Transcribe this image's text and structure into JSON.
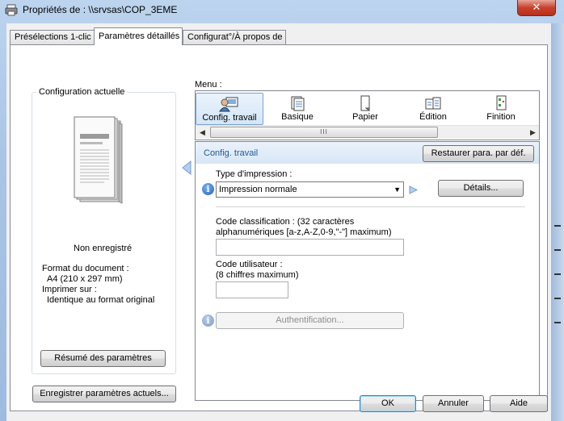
{
  "window": {
    "title": "Propriétés de : \\\\srvsas\\COP_3EME",
    "close_label": "✕"
  },
  "tabs": [
    {
      "label": "Présélections 1-clic",
      "active": false
    },
    {
      "label": "Paramètres détaillés",
      "active": true
    },
    {
      "label": "Configurat°/À propos de",
      "active": false
    }
  ],
  "left_panel": {
    "group_title": "Configuration actuelle",
    "status": "Non enregistré",
    "doc_format_label": "Format du document :",
    "doc_format_value": "A4 (210 x 297 mm)",
    "print_on_label": "Imprimer sur :",
    "print_on_value": "Identique au format original",
    "summary_button": "Résumé des paramètres",
    "save_button": "Enregistrer paramètres actuels..."
  },
  "menu": {
    "label": "Menu :",
    "items": [
      {
        "label": "Config. travail",
        "icon": "job-config-icon",
        "selected": true
      },
      {
        "label": "Basique",
        "icon": "basic-icon",
        "selected": false
      },
      {
        "label": "Papier",
        "icon": "paper-icon",
        "selected": false
      },
      {
        "label": "Édition",
        "icon": "edition-icon",
        "selected": false
      },
      {
        "label": "Finition",
        "icon": "finishing-icon",
        "selected": false
      }
    ],
    "scroll_thumb": "III"
  },
  "content": {
    "title": "Config. travail",
    "restore_button": "Restaurer para. par déf.",
    "print_type_label": "Type d'impression :",
    "print_type_value": "Impression normale",
    "details_button": "Détails...",
    "classification_label_1": "Code classification : (32 caractères",
    "classification_label_2": " alphanumériques [a-z,A-Z,0-9,\"-\"] maximum)",
    "classification_value": "",
    "user_code_label_1": "Code utilisateur :",
    "user_code_label_2": "(8 chiffres maximum)",
    "user_code_value": "",
    "auth_button": "Authentification..."
  },
  "footer": {
    "ok": "OK",
    "cancel": "Annuler",
    "help": "Aide"
  },
  "colors": {
    "accent": "#1e5a99",
    "selection": "#d3e6f8"
  }
}
